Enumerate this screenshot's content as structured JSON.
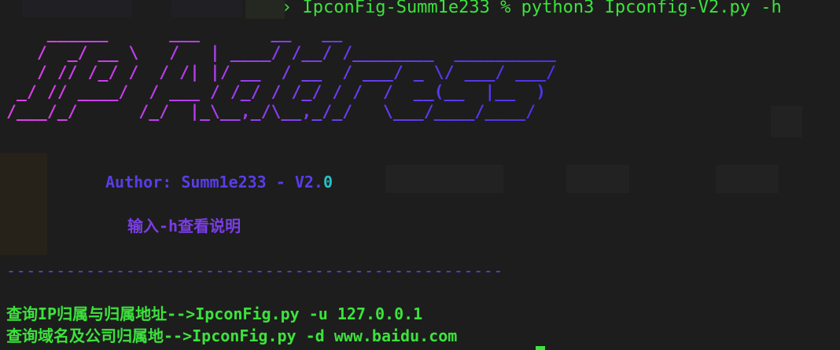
{
  "terminal": {
    "command_line": "› IpconFig-Summ1e233 % python3 Ipconfig-V2.py -h",
    "banner_lines": [
      "    ______      ___       __   __",
      "   /  _/ __ \\   /   | ____/ /__/ /________  __________",
      "   / // /_/ /  / /| |/ __  / __  / ___/ _ \\/ ___/ ___/",
      " _/ // ____/  / ___ / /_/ / /_/ / /  /  __(__  |__  )",
      "/___/_/      /_/  |_\\__,_/\\__,_/_/   \\___/____/____/"
    ],
    "author_prefix": "Author: Summ1e233 - V2.",
    "author_suffix": "0",
    "hint": "输入-h查看说明",
    "divider": "--------------------------------------------------",
    "usage_lines": [
      "查询IP归属与归属地址-->IpconFig.py -u 127.0.0.1",
      "查询域名及公司归属地-->IpconFig.py -d www.baidu.com"
    ],
    "colors": {
      "background": "#1d1d1d",
      "green": "#3ce33c",
      "purple": "#5a3de8",
      "magenta": "#e040e6",
      "cyan": "#28c0c8"
    }
  }
}
